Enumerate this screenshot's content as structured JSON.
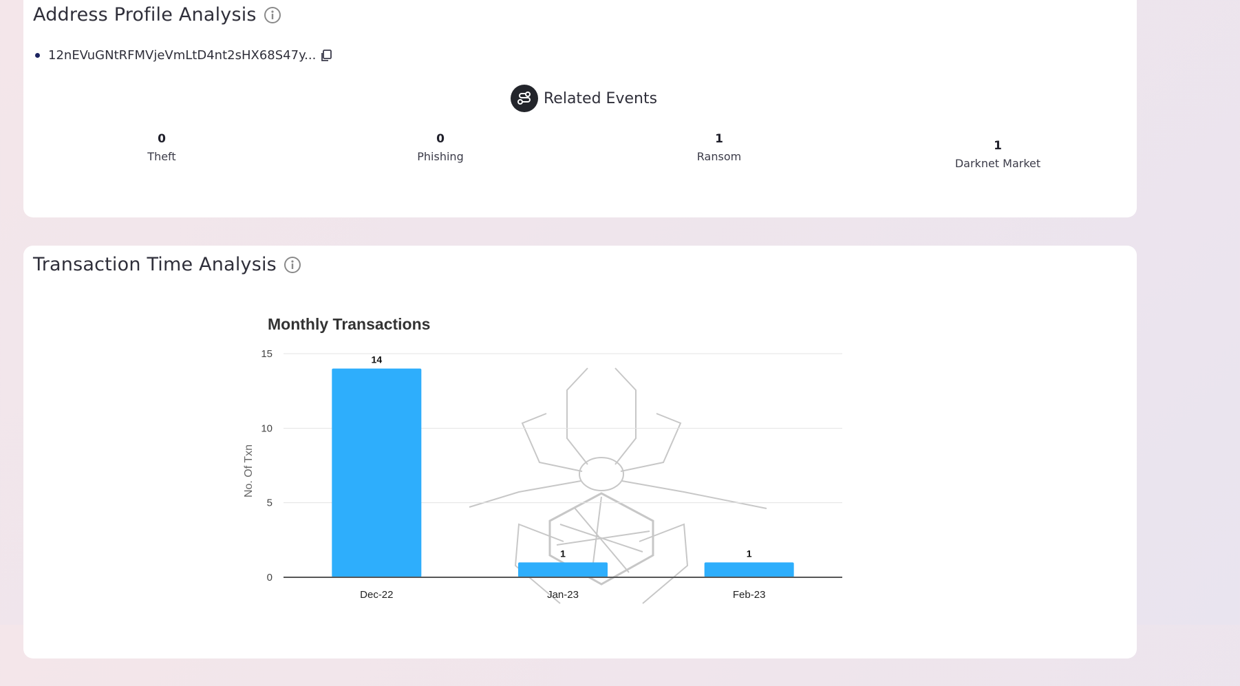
{
  "address_profile": {
    "title": "Address Profile Analysis",
    "address": "12nEVuGNtRFMVjeVmLtD4nt2sHX68S47y...",
    "related_events_title": "Related Events",
    "events": [
      {
        "value": "0",
        "label": "Theft"
      },
      {
        "value": "0",
        "label": "Phishing"
      },
      {
        "value": "1",
        "label": "Ransom"
      },
      {
        "value": "1",
        "label": "Darknet Market"
      }
    ]
  },
  "transaction_time": {
    "title": "Transaction Time Analysis"
  },
  "colors": {
    "bar": "#2eaefc",
    "grid": "#e3e3e3",
    "axis": "#555555"
  },
  "chart_data": {
    "type": "bar",
    "title": "Monthly Transactions",
    "xlabel": "",
    "ylabel": "No. Of Txn",
    "categories": [
      "Dec-22",
      "Jan-23",
      "Feb-23"
    ],
    "values": [
      14,
      1,
      1
    ],
    "ylim": [
      0,
      15
    ],
    "yticks": [
      0,
      5,
      10,
      15
    ],
    "grid": true,
    "data_labels": true
  }
}
